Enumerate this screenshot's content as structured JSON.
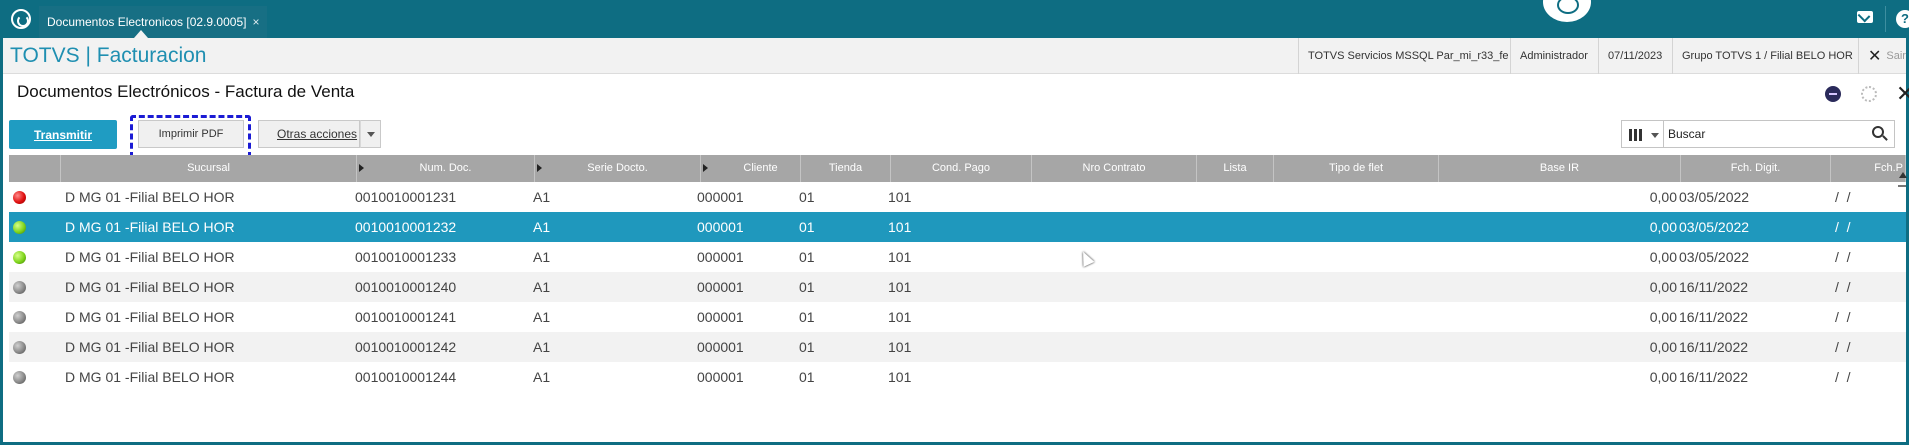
{
  "topbar": {
    "tab_label": "Documentos Electronicos [02.9.0005]",
    "tab_close": "×"
  },
  "header": {
    "brand": "TOTVS | Facturacion",
    "server": "TOTVS Servicios MSSQL Par_mi_r33_fe",
    "user": "Administrador",
    "date": "07/11/2023",
    "group": "Grupo TOTVS 1 / Filial BELO HOR",
    "exit_label": "Sair",
    "exit_icon": "✕"
  },
  "page": {
    "title": "Documentos Electrónicos - Factura de Venta",
    "close_glyph": "✕"
  },
  "actions": {
    "transmitir": "Transmitir",
    "imprimir": "Imprimir PDF",
    "otras": "Otras acciones"
  },
  "search": {
    "placeholder": "Buscar"
  },
  "table": {
    "columns": [
      "Sucursal",
      "Num. Doc.",
      "Serie Docto.",
      "Cliente",
      "Tienda",
      "Cond. Pago",
      "Nro Contrato",
      "Lista",
      "Tipo de flet",
      "Base IR",
      "Fch. Digit.",
      "Fch.P"
    ],
    "rows": [
      {
        "status": "red",
        "sucursal": "D MG 01 -Filial BELO HOR",
        "num": "0010010001231",
        "serie": "A1",
        "cliente": "000001",
        "tienda": "01",
        "cond": "101",
        "base": "0,00",
        "fecha": "03/05/2022",
        "fchp": "/  /"
      },
      {
        "status": "green",
        "sucursal": "D MG 01 -Filial BELO HOR",
        "num": "0010010001232",
        "serie": "A1",
        "cliente": "000001",
        "tienda": "01",
        "cond": "101",
        "base": "0,00",
        "fecha": "03/05/2022",
        "fchp": "/  /"
      },
      {
        "status": "green",
        "sucursal": "D MG 01 -Filial BELO HOR",
        "num": "0010010001233",
        "serie": "A1",
        "cliente": "000001",
        "tienda": "01",
        "cond": "101",
        "base": "0,00",
        "fecha": "03/05/2022",
        "fchp": "/  /"
      },
      {
        "status": "gray",
        "sucursal": "D MG 01 -Filial BELO HOR",
        "num": "0010010001240",
        "serie": "A1",
        "cliente": "000001",
        "tienda": "01",
        "cond": "101",
        "base": "0,00",
        "fecha": "16/11/2022",
        "fchp": "/  /"
      },
      {
        "status": "gray",
        "sucursal": "D MG 01 -Filial BELO HOR",
        "num": "0010010001241",
        "serie": "A1",
        "cliente": "000001",
        "tienda": "01",
        "cond": "101",
        "base": "0,00",
        "fecha": "16/11/2022",
        "fchp": "/  /"
      },
      {
        "status": "gray",
        "sucursal": "D MG 01 -Filial BELO HOR",
        "num": "0010010001242",
        "serie": "A1",
        "cliente": "000001",
        "tienda": "01",
        "cond": "101",
        "base": "0,00",
        "fecha": "16/11/2022",
        "fchp": "/  /"
      },
      {
        "status": "gray",
        "sucursal": "D MG 01 -Filial BELO HOR",
        "num": "0010010001244",
        "serie": "A1",
        "cliente": "000001",
        "tienda": "01",
        "cond": "101",
        "base": "0,00",
        "fecha": "16/11/2022",
        "fchp": "/  /"
      }
    ]
  },
  "colors": {
    "topbar": "#0e6d82",
    "accent": "#1f9cc2",
    "selected_row": "#1f98bd",
    "header_gray": "#a6a6a6"
  }
}
